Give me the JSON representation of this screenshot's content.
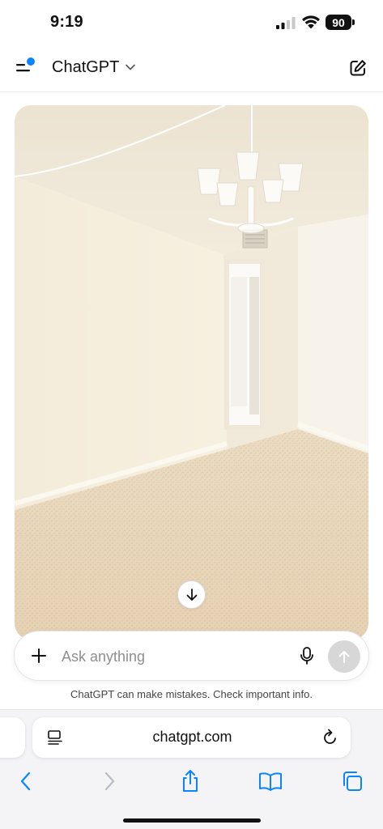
{
  "status_bar": {
    "time": "9:19",
    "battery": "90"
  },
  "header": {
    "title": "ChatGPT"
  },
  "composer": {
    "placeholder": "Ask anything"
  },
  "disclaimer": "ChatGPT can make mistakes. Check important info.",
  "browser": {
    "url": "chatgpt.com"
  },
  "icons": {
    "menu": "sidebar-menu-icon",
    "new_chat": "edit-icon",
    "scroll": "arrow-down-icon",
    "plus": "plus-icon",
    "mic": "microphone-icon",
    "send": "arrow-up-icon",
    "reader": "reader-icon",
    "reload": "reload-icon",
    "back": "chevron-left-icon",
    "forward": "chevron-right-icon",
    "share": "share-icon",
    "bookmarks": "book-icon",
    "tabs": "tabs-icon"
  },
  "colors": {
    "accent": "#0a84ff",
    "notification_dot": "#0a84ff",
    "send_disabled": "#d7d7d7"
  }
}
